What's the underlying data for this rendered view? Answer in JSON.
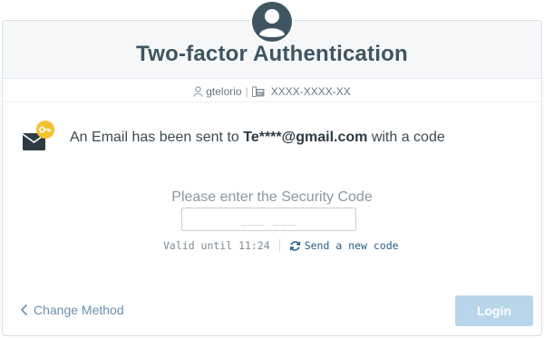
{
  "header": {
    "title": "Two-factor Authentication",
    "username": "gtelorio",
    "phone": "XXXX-XXXX-XX"
  },
  "message": {
    "prefix": "An Email has been sent to",
    "email": "Te****@gmail.com",
    "suffix": "with a code"
  },
  "code": {
    "prompt": "Please enter the Security Code",
    "placeholder": "___ ___",
    "valid_until": "Valid until 11:24",
    "resend_label": "Send a new code"
  },
  "footer": {
    "change_method_label": "Change Method",
    "login_label": "Login"
  },
  "colors": {
    "title": "#3f5562",
    "accent_link": "#2a5b86",
    "login_button": "#b9d5ea",
    "key_badge": "#f2c22e"
  },
  "icons": {
    "avatar": "user-avatar-icon",
    "user": "user-icon",
    "phone": "phone-icon",
    "mail_key": "email-key-icon",
    "refresh": "refresh-icon",
    "chevron": "chevron-left-icon"
  }
}
